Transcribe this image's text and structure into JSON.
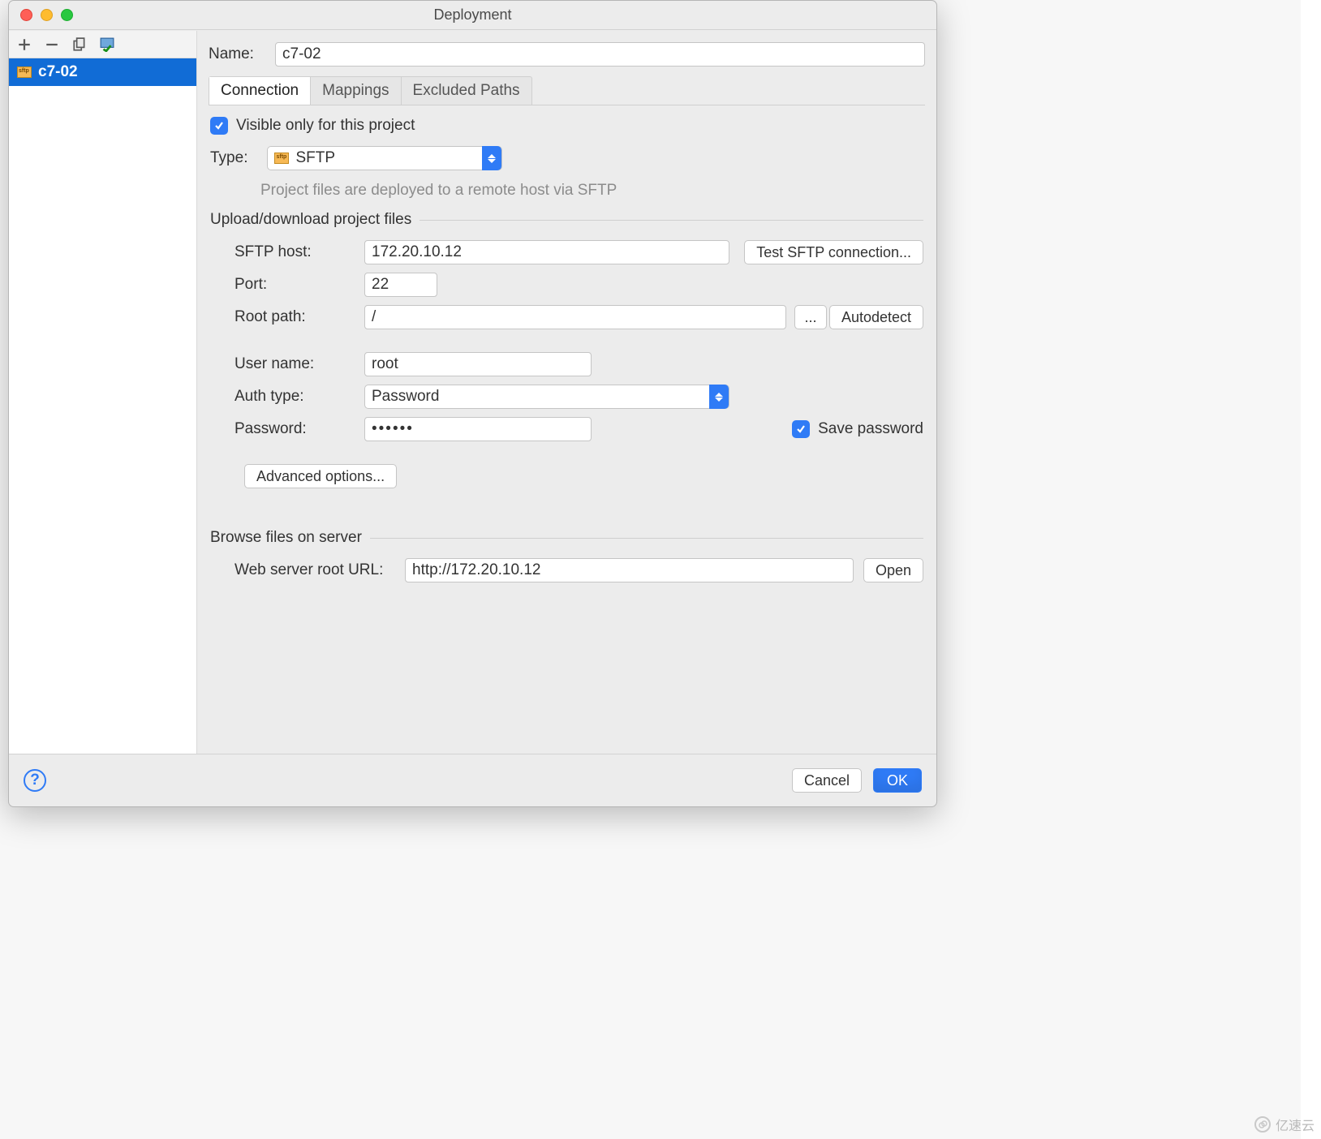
{
  "window": {
    "title": "Deployment"
  },
  "sidebar": {
    "items": [
      {
        "label": "c7-02"
      }
    ]
  },
  "form": {
    "name_label": "Name:",
    "name_value": "c7-02",
    "tabs": [
      "Connection",
      "Mappings",
      "Excluded Paths"
    ],
    "visible_only_label": "Visible only for this project",
    "visible_only_checked": true,
    "type_label": "Type:",
    "type_value": "SFTP",
    "type_hint": "Project files are deployed to a remote host via SFTP",
    "upload_section": "Upload/download project files",
    "sftp_host_label": "SFTP host:",
    "sftp_host_value": "172.20.10.12",
    "test_button": "Test SFTP connection...",
    "port_label": "Port:",
    "port_value": "22",
    "root_label": "Root path:",
    "root_value": "/",
    "browse_button": "...",
    "autodetect_button": "Autodetect",
    "user_label": "User name:",
    "user_value": "root",
    "auth_label": "Auth type:",
    "auth_value": "Password",
    "password_label": "Password:",
    "password_value": "••••••",
    "save_password_label": "Save password",
    "save_password_checked": true,
    "advanced_button": "Advanced options...",
    "browse_section": "Browse files on server",
    "web_root_label": "Web server root URL:",
    "web_root_value": "http://172.20.10.12",
    "open_button": "Open"
  },
  "footer": {
    "cancel": "Cancel",
    "ok": "OK"
  },
  "watermark": "亿速云"
}
